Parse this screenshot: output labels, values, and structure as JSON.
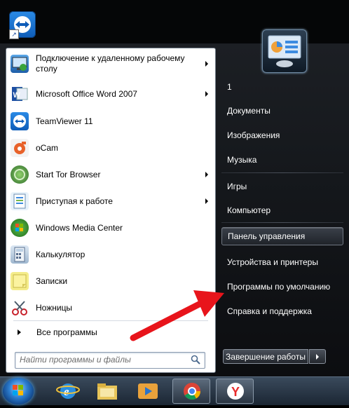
{
  "programs": [
    {
      "label": "Подключение к удаленному рабочему столу",
      "icon": "remote-desktop-icon",
      "has_submenu": true
    },
    {
      "label": "Microsoft Office Word 2007",
      "icon": "word-icon",
      "has_submenu": true
    },
    {
      "label": "TeamViewer 11",
      "icon": "teamviewer-icon",
      "has_submenu": false
    },
    {
      "label": "oCam",
      "icon": "ocam-icon",
      "has_submenu": false
    },
    {
      "label": "Start Tor Browser",
      "icon": "tor-browser-icon",
      "has_submenu": true
    },
    {
      "label": "Приступая к работе",
      "icon": "getting-started-icon",
      "has_submenu": true
    },
    {
      "label": "Windows Media Center",
      "icon": "media-center-icon",
      "has_submenu": false
    },
    {
      "label": "Калькулятор",
      "icon": "calculator-icon",
      "has_submenu": false
    },
    {
      "label": "Записки",
      "icon": "sticky-notes-icon",
      "has_submenu": false
    },
    {
      "label": "Ножницы",
      "icon": "snipping-tool-icon",
      "has_submenu": false
    }
  ],
  "all_programs_label": "Все программы",
  "search": {
    "placeholder": "Найти программы и файлы"
  },
  "right_items": {
    "user": "1",
    "documents": "Документы",
    "pictures": "Изображения",
    "music": "Музыка",
    "games": "Игры",
    "computer": "Компьютер",
    "control_panel": "Панель управления",
    "devices": "Устройства и принтеры",
    "default_programs": "Программы по умолчанию",
    "help": "Справка и поддержка"
  },
  "shutdown_label": "Завершение работы",
  "taskbar": [
    "start-orb",
    "internet-explorer-icon",
    "explorer-icon",
    "media-player-icon",
    "chrome-icon",
    "yandex-browser-icon"
  ],
  "colors": {
    "accent_arrow": "#e8141b",
    "menu_dark": "#15181c"
  }
}
